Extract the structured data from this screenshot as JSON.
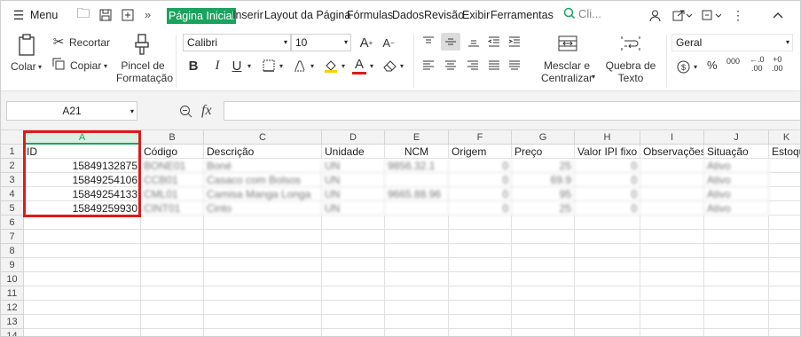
{
  "menubar": {
    "menu_label": "Menu",
    "tabs": [
      "Página Inicial",
      "Inserir",
      "Layout da Página",
      "Fórmulas",
      "Dados",
      "Revisão",
      "Exibir",
      "Ferramentas"
    ],
    "search_placeholder": "Cli..."
  },
  "ribbon": {
    "cut_label": "Recortar",
    "paste_label": "Colar",
    "copy_label": "Copiar",
    "format_painter_label": "Pincel de\nFormatação",
    "font_name": "Calibri",
    "font_size": "10",
    "merge_label": "Mesclar e\nCentralizar",
    "wrap_label": "Quebra de\nTexto",
    "number_format": "Geral",
    "pct_symbol": "%",
    "thousands_symbol": "000",
    "dec_inc_label": "+0\n.00",
    "dec_dec_label": "←.0\n.00"
  },
  "formula_bar": {
    "cell_ref": "A21",
    "fx_label": "fx",
    "value": ""
  },
  "columns": [
    "A",
    "B",
    "C",
    "D",
    "E",
    "F",
    "G",
    "H",
    "I",
    "J",
    "K"
  ],
  "rows": [
    "1",
    "2",
    "3",
    "4",
    "5",
    "6",
    "7",
    "8",
    "9",
    "10",
    "11",
    "12",
    "13",
    "14"
  ],
  "headers": [
    "ID",
    "Código",
    "Descrição",
    "Unidade",
    "NCM",
    "Origem",
    "Preço",
    "Valor IPI fixo",
    "Observações",
    "Situação",
    "Estoque"
  ],
  "data_rows": [
    {
      "id": "15849132875",
      "codigo": "BONE01",
      "descricao": "Boné",
      "unidade": "UN",
      "ncm": "9856.32.1",
      "origem": "0",
      "preco": "25",
      "ipi": "0",
      "obs": "",
      "situacao": "Ativo"
    },
    {
      "id": "15849254106",
      "codigo": "CCB01",
      "descricao": "Casaco com Bolsos",
      "unidade": "UN",
      "ncm": "",
      "origem": "0",
      "preco": "69.9",
      "ipi": "0",
      "obs": "",
      "situacao": "Ativo"
    },
    {
      "id": "15849254133",
      "codigo": "CML01",
      "descricao": "Camisa Manga Longa",
      "unidade": "UN",
      "ncm": "9665.88.96",
      "origem": "0",
      "preco": "95",
      "ipi": "0",
      "obs": "",
      "situacao": "Ativo"
    },
    {
      "id": "15849259930",
      "codigo": "CINT01",
      "descricao": "Cinto",
      "unidade": "UN",
      "ncm": "",
      "origem": "0",
      "preco": "25",
      "ipi": "0",
      "obs": "",
      "situacao": "Ativo"
    }
  ],
  "colors": {
    "active_tab": "#1aa35e",
    "highlight": "#e01a1a",
    "selected_col": "#1aa35e"
  }
}
